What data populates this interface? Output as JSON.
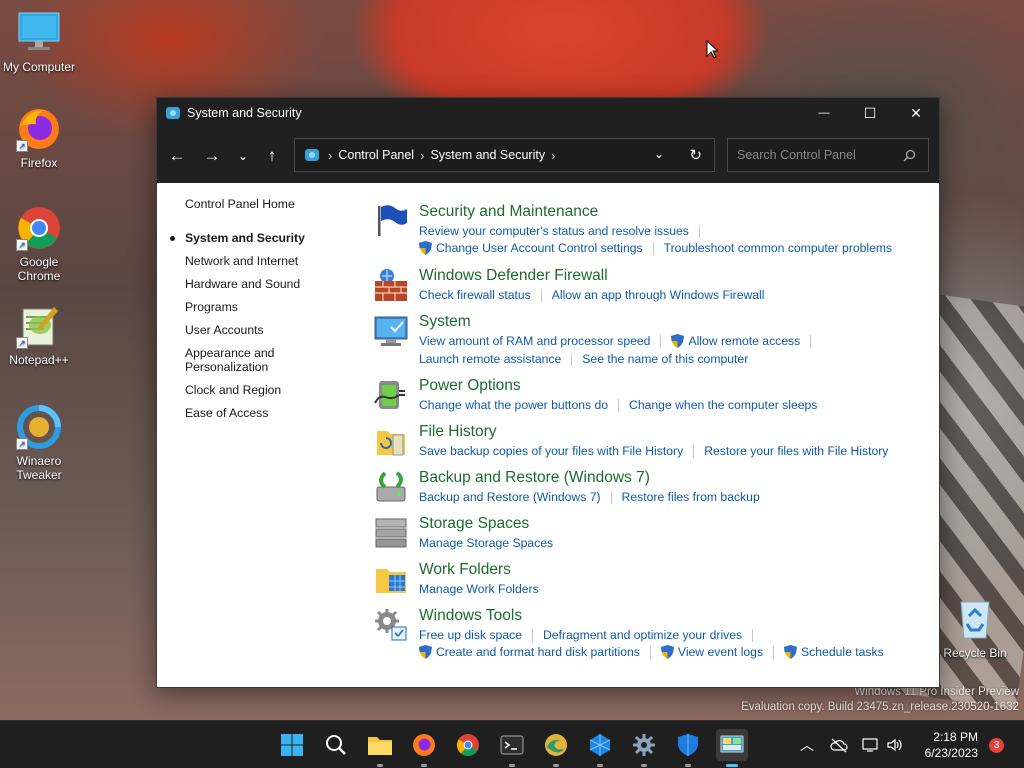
{
  "desktop": {
    "icons": [
      {
        "label": "My Computer"
      },
      {
        "label": "Firefox"
      },
      {
        "label": "Google Chrome"
      },
      {
        "label": "Notepad++"
      },
      {
        "label": "Winaero Tweaker"
      },
      {
        "label": "Recycle Bin"
      }
    ],
    "watermark": {
      "line1": "Windows 11 Pro Insider Preview",
      "line2": "Evaluation copy. Build 23475.zn_release.230520-1632"
    }
  },
  "window": {
    "title": "System and Security",
    "controls": {
      "minimize": "—",
      "maximize": "☐",
      "close": "✕"
    },
    "address": {
      "crumbs": [
        "Control Panel",
        "System and Security"
      ],
      "separator": "›"
    },
    "search": {
      "placeholder": "Search Control Panel"
    },
    "leftnav": {
      "home": "Control Panel Home",
      "items": [
        "System and Security",
        "Network and Internet",
        "Hardware and Sound",
        "Programs",
        "User Accounts",
        "Appearance and Personalization",
        "Clock and Region",
        "Ease of Access"
      ]
    },
    "categories": [
      {
        "title": "Security and Maintenance",
        "icon": "flag-icon",
        "lines": [
          [
            {
              "text": "Review your computer's status and resolve issues",
              "shield": false
            }
          ],
          [
            {
              "text": "Change User Account Control settings",
              "shield": true
            },
            {
              "text": "Troubleshoot common computer problems",
              "shield": false
            }
          ]
        ]
      },
      {
        "title": "Windows Defender Firewall",
        "icon": "firewall-icon",
        "lines": [
          [
            {
              "text": "Check firewall status",
              "shield": false
            },
            {
              "text": "Allow an app through Windows Firewall",
              "shield": false
            }
          ]
        ]
      },
      {
        "title": "System",
        "icon": "monitor-icon",
        "lines": [
          [
            {
              "text": "View amount of RAM and processor speed",
              "shield": false
            },
            {
              "text": "Allow remote access",
              "shield": true
            }
          ],
          [
            {
              "text": "Launch remote assistance",
              "shield": false
            },
            {
              "text": "See the name of this computer",
              "shield": false
            }
          ]
        ]
      },
      {
        "title": "Power Options",
        "icon": "battery-icon",
        "lines": [
          [
            {
              "text": "Change what the power buttons do",
              "shield": false
            },
            {
              "text": "Change when the computer sleeps",
              "shield": false
            }
          ]
        ]
      },
      {
        "title": "File History",
        "icon": "file-history-icon",
        "lines": [
          [
            {
              "text": "Save backup copies of your files with File History",
              "shield": false
            },
            {
              "text": "Restore your files with File History",
              "shield": false
            }
          ]
        ]
      },
      {
        "title": "Backup and Restore (Windows 7)",
        "icon": "backup-icon",
        "lines": [
          [
            {
              "text": "Backup and Restore (Windows 7)",
              "shield": false
            },
            {
              "text": "Restore files from backup",
              "shield": false
            }
          ]
        ]
      },
      {
        "title": "Storage Spaces",
        "icon": "storage-icon",
        "lines": [
          [
            {
              "text": "Manage Storage Spaces",
              "shield": false
            }
          ]
        ]
      },
      {
        "title": "Work Folders",
        "icon": "work-folders-icon",
        "lines": [
          [
            {
              "text": "Manage Work Folders",
              "shield": false
            }
          ]
        ]
      },
      {
        "title": "Windows Tools",
        "icon": "tools-icon",
        "lines": [
          [
            {
              "text": "Free up disk space",
              "shield": false
            },
            {
              "text": "Defragment and optimize your drives",
              "shield": false
            }
          ],
          [
            {
              "text": "Create and format hard disk partitions",
              "shield": true
            },
            {
              "text": "View event logs",
              "shield": true
            },
            {
              "text": "Schedule tasks",
              "shield": true
            }
          ]
        ]
      }
    ]
  },
  "taskbar": {
    "apps": [
      "start-icon",
      "search-icon",
      "file-explorer-icon",
      "firefox-icon",
      "chrome-icon",
      "terminal-icon",
      "edge-canary-icon",
      "azure-icon",
      "settings-icon",
      "defender-icon",
      "control-panel-icon"
    ],
    "clock": {
      "time": "2:18 PM",
      "date": "6/23/2023"
    },
    "notifications": "3"
  },
  "colors": {
    "title_green": "#1e6b2e",
    "link_blue": "#0f5aa8",
    "titlebar": "#202020",
    "taskbar": "#1f1f1f"
  }
}
